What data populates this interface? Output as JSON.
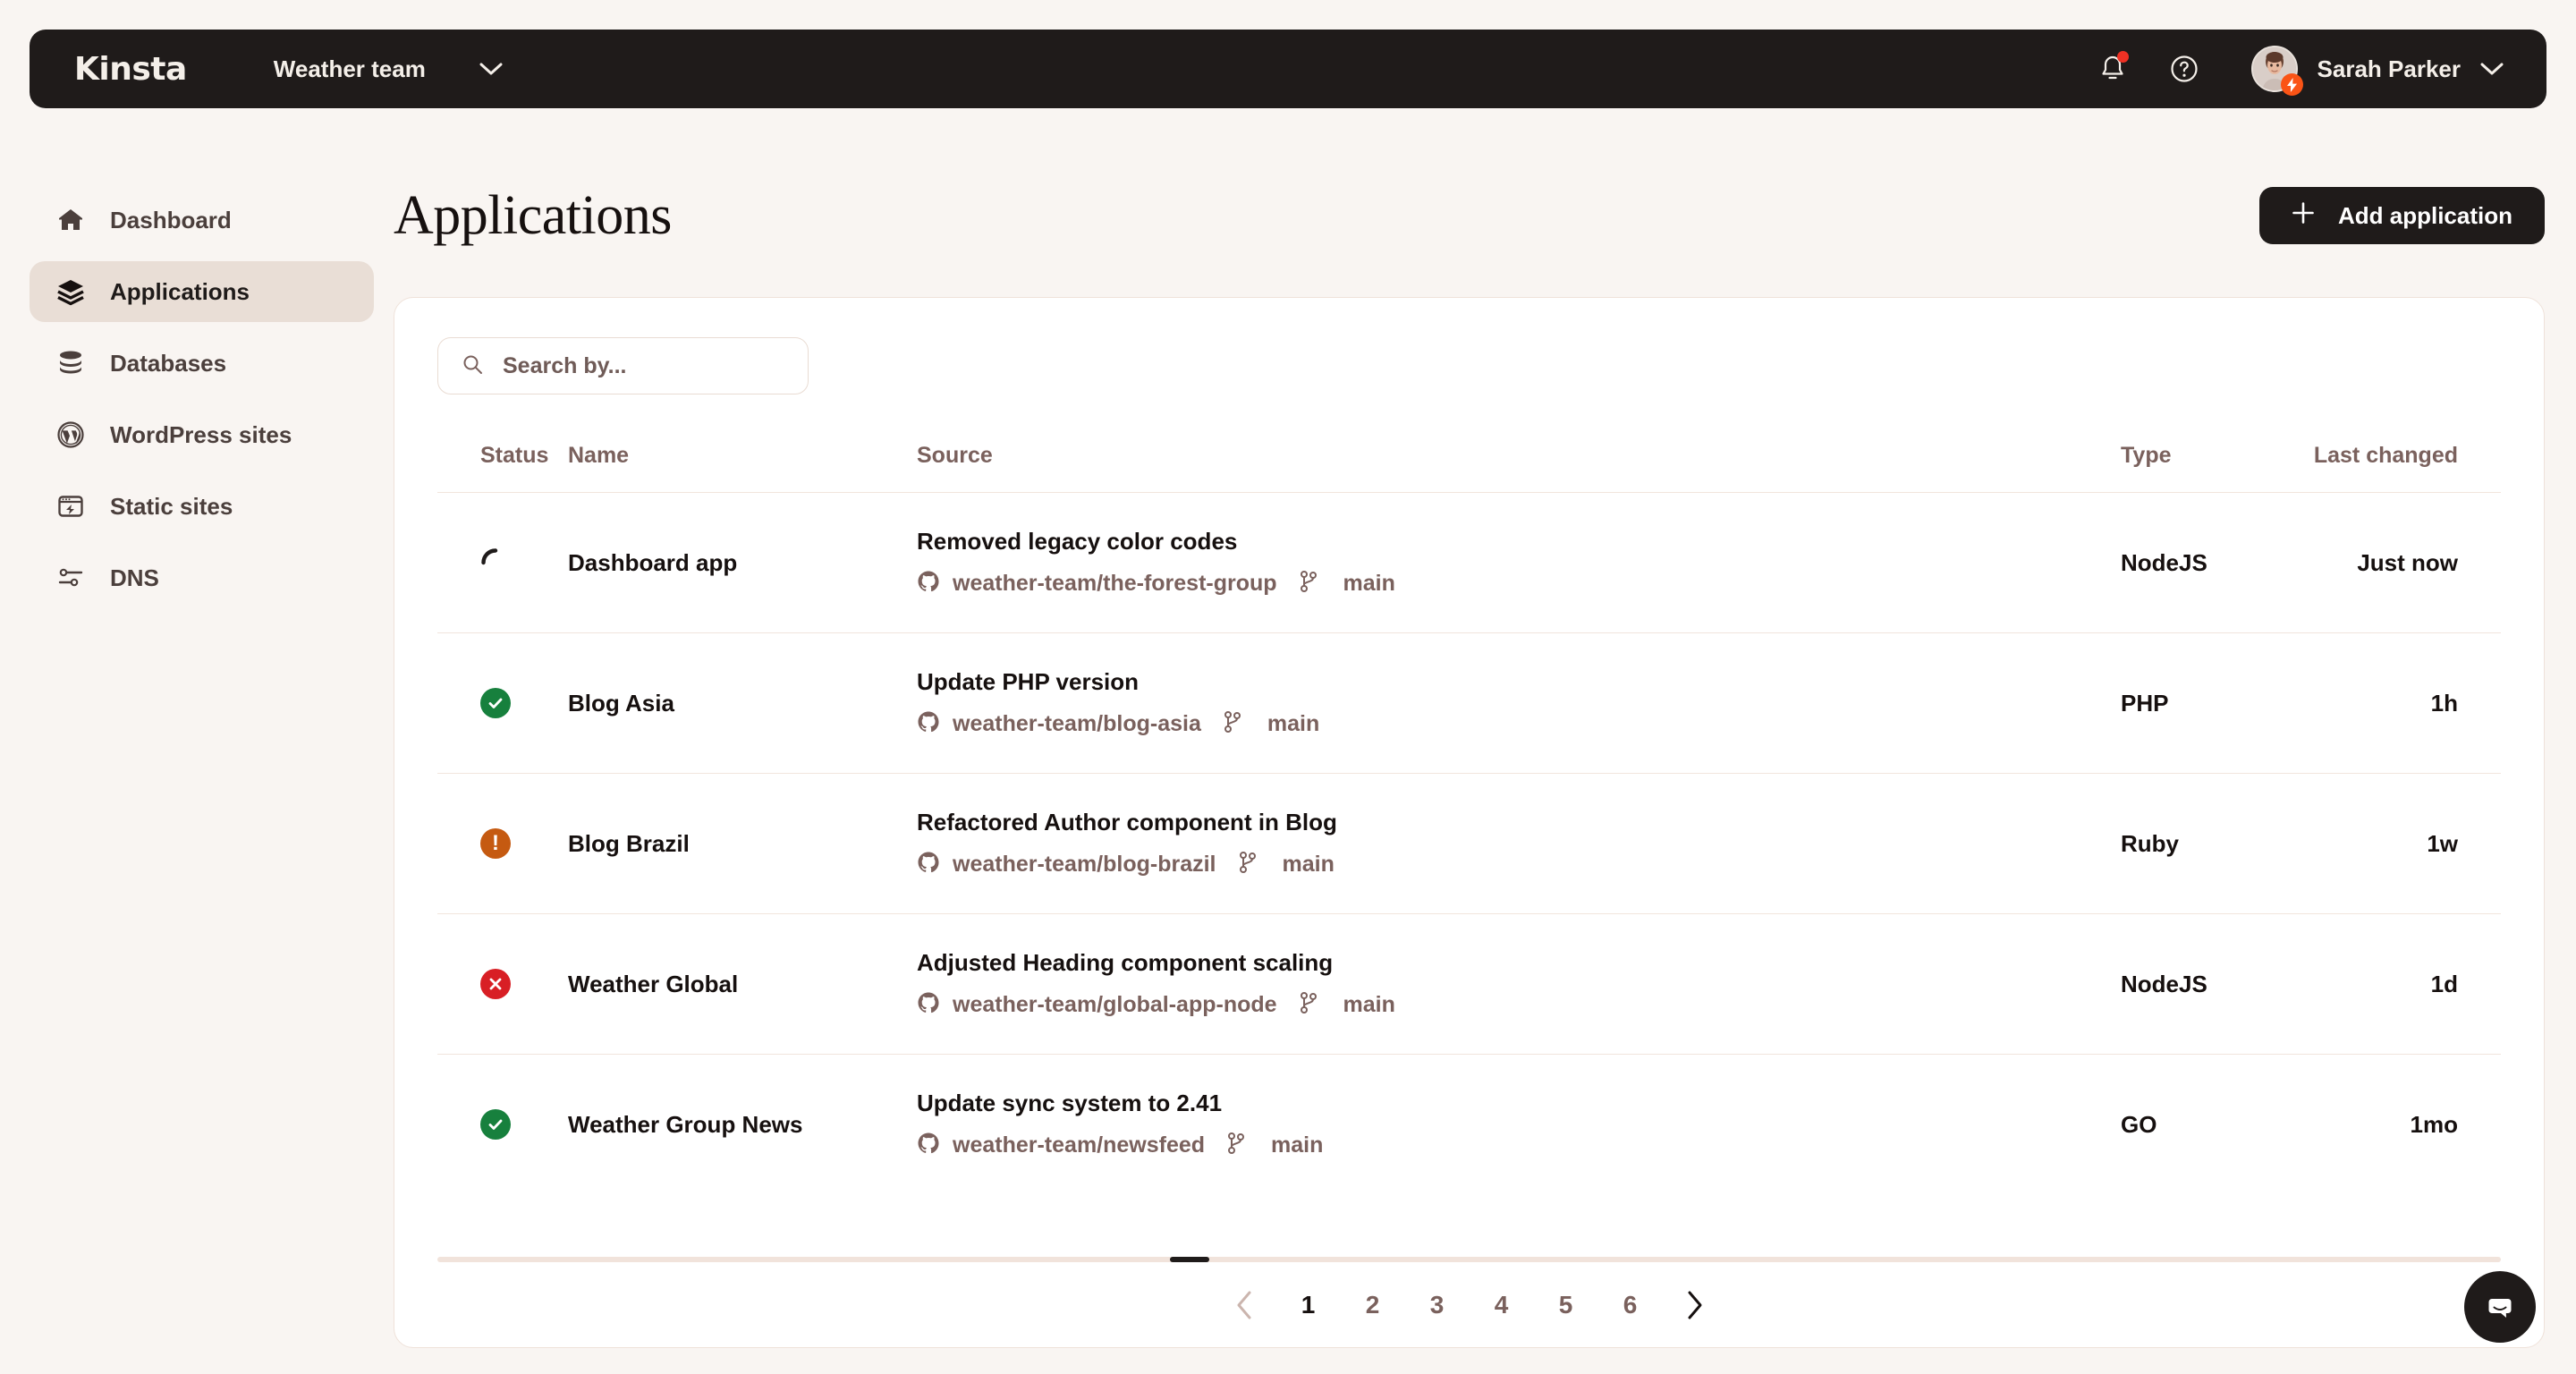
{
  "topbar": {
    "brand": "Kinsta",
    "team": "Weather team",
    "user": "Sarah Parker",
    "icons": {
      "team_chevron": "chevron-down-icon",
      "notifications": "bell-icon",
      "help": "help-circle-icon",
      "user_chevron": "chevron-down-icon"
    },
    "colors": {
      "bar": "#1f1b1a",
      "notif_dot": "#ef3124",
      "badge": "#fa5416"
    }
  },
  "sidebar": {
    "items": [
      {
        "label": "Dashboard",
        "icon": "home-icon",
        "active": false
      },
      {
        "label": "Applications",
        "icon": "layers-icon",
        "active": true
      },
      {
        "label": "Databases",
        "icon": "database-icon",
        "active": false
      },
      {
        "label": "WordPress sites",
        "icon": "wordpress-icon",
        "active": false
      },
      {
        "label": "Static sites",
        "icon": "static-site-icon",
        "active": false
      },
      {
        "label": "DNS",
        "icon": "dns-icon",
        "active": false
      }
    ],
    "active_bg": "#e9ded6"
  },
  "page": {
    "title": "Applications",
    "add_button": "Add application",
    "add_icon": "plus-icon"
  },
  "search": {
    "placeholder": "Search by...",
    "value": "",
    "icon": "search-icon"
  },
  "table": {
    "headers": {
      "status": "Status",
      "name": "Name",
      "source": "Source",
      "type": "Type",
      "last_changed": "Last changed"
    },
    "rows": [
      {
        "status": "loading",
        "name": "Dashboard app",
        "commit": "Removed legacy color codes",
        "repo": "weather-team/the-forest-group",
        "branch": "main",
        "type": "NodeJS",
        "last_changed": "Just now"
      },
      {
        "status": "success",
        "name": "Blog Asia",
        "commit": "Update PHP version",
        "repo": "weather-team/blog-asia",
        "branch": "main",
        "type": "PHP",
        "last_changed": "1h"
      },
      {
        "status": "warning",
        "name": "Blog Brazil",
        "commit": "Refactored Author component in Blog",
        "repo": "weather-team/blog-brazil",
        "branch": "main",
        "type": "Ruby",
        "last_changed": "1w"
      },
      {
        "status": "error",
        "name": "Weather Global",
        "commit": "Adjusted Heading component scaling",
        "repo": "weather-team/global-app-node",
        "branch": "main",
        "type": "NodeJS",
        "last_changed": "1d"
      },
      {
        "status": "success",
        "name": "Weather Group News",
        "commit": "Update sync system to 2.41",
        "repo": "weather-team/newsfeed",
        "branch": "main",
        "type": "GO",
        "last_changed": "1mo"
      }
    ],
    "status_colors": {
      "success": "#17803d",
      "warning": "#c55a11",
      "error": "#d81f25",
      "loading": "#1f1b1a"
    },
    "row_icons": {
      "repo": "github-icon",
      "branch": "git-branch-icon"
    }
  },
  "pagination": {
    "prev": "chevron-left-icon",
    "next": "chevron-right-icon",
    "pages": [
      "1",
      "2",
      "3",
      "4",
      "5",
      "6"
    ],
    "current": "1"
  },
  "chat": {
    "icon": "chat-bubble-icon"
  }
}
